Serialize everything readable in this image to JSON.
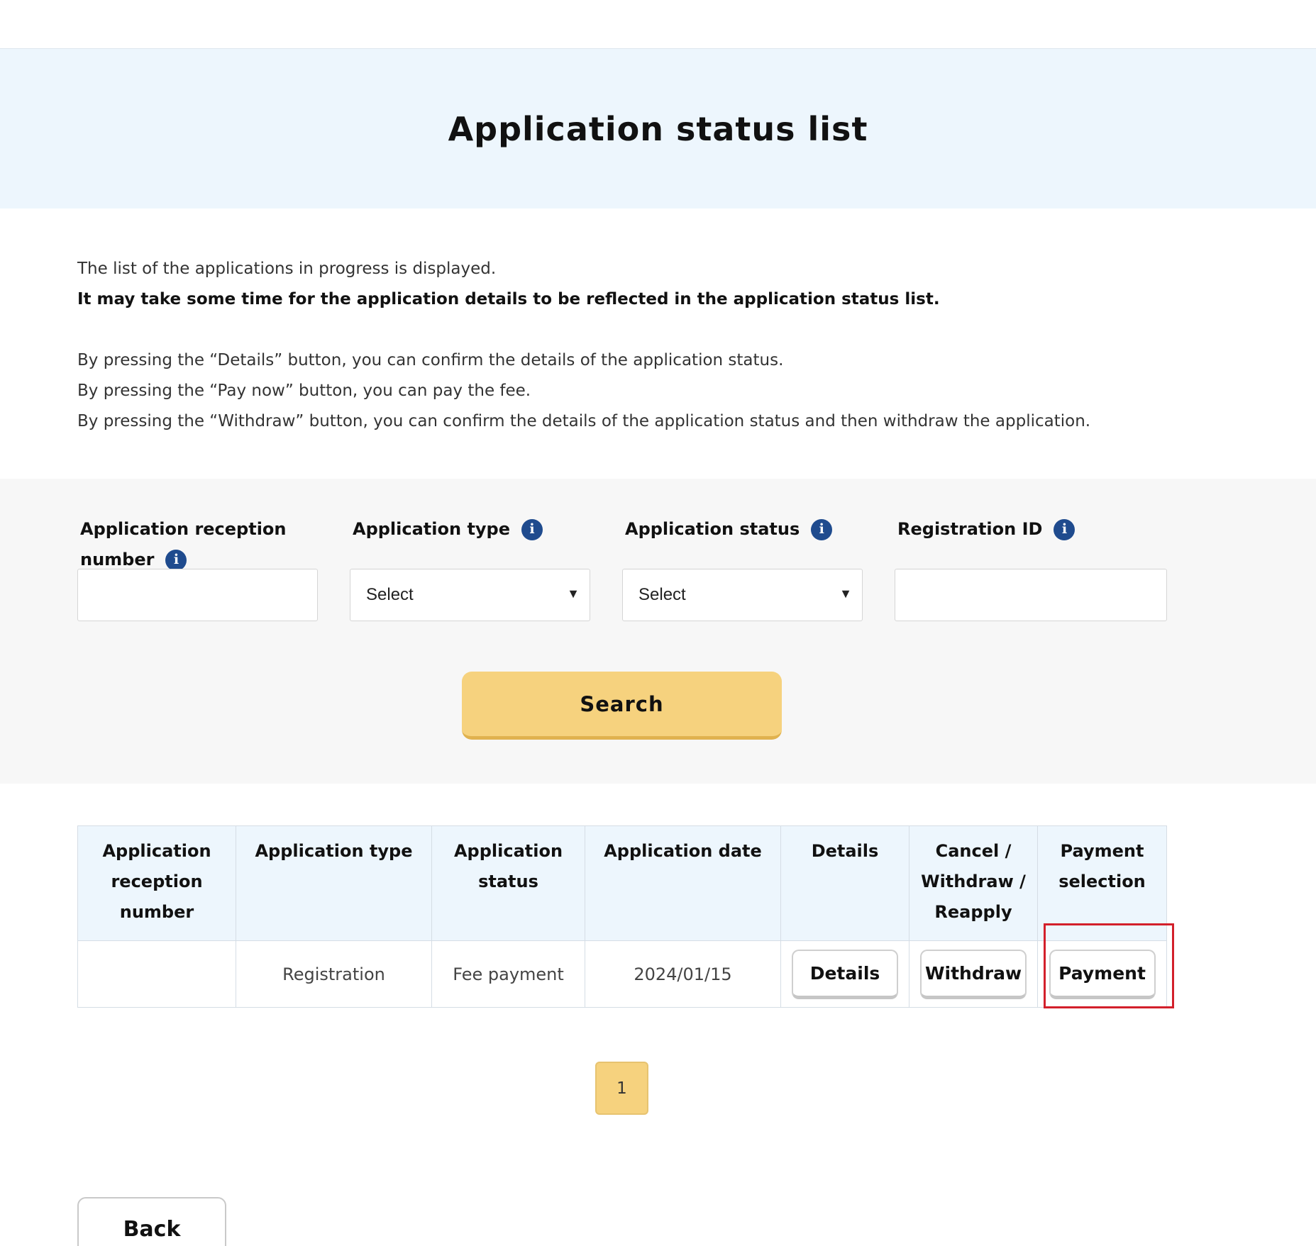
{
  "page": {
    "title": "Application status list"
  },
  "intro": {
    "line1": "The list of the applications in progress is displayed.",
    "line2": "It may take some time for the application details to be reflected in the application status list.",
    "line3": "By pressing the “Details” button, you can confirm the details of the application status.",
    "line4": "By pressing the “Pay now” button, you can pay the fee.",
    "line5": "By pressing the “Withdraw” button, you can confirm the details of the application status and then withdraw the application."
  },
  "filters": {
    "reception_number": {
      "label_line1": "Application reception",
      "label_line2": "number",
      "value": ""
    },
    "application_type": {
      "label": "Application type",
      "selected": "Select"
    },
    "application_status": {
      "label": "Application status",
      "selected": "Select"
    },
    "registration_id": {
      "label": "Registration ID",
      "value": ""
    },
    "search_label": "Search"
  },
  "table": {
    "headers": {
      "reception_number": [
        "Application",
        "reception",
        "number"
      ],
      "application_type": [
        "Application type"
      ],
      "application_status": [
        "Application",
        "status"
      ],
      "application_date": [
        "Application date"
      ],
      "details": [
        "Details"
      ],
      "cancel": [
        "Cancel /",
        "Withdraw /",
        "Reapply"
      ],
      "payment": [
        "Payment",
        "selection"
      ]
    },
    "rows": [
      {
        "reception_number": "",
        "application_type": "Registration",
        "application_status": "Fee payment",
        "application_date": "2024/01/15",
        "details_button": "Details",
        "withdraw_button": "Withdraw",
        "payment_button": "Payment"
      }
    ]
  },
  "pagination": {
    "current": "1"
  },
  "back_label": "Back",
  "colors": {
    "banner_bg": "#edf6fd",
    "filter_bg": "#f7f7f7",
    "accent_yellow": "#f6d27e",
    "info_icon": "#1f4b8e",
    "highlight_red": "#d3202b"
  },
  "icons": {
    "info": "info-circle-icon",
    "dropdown": "caret-down-icon"
  }
}
